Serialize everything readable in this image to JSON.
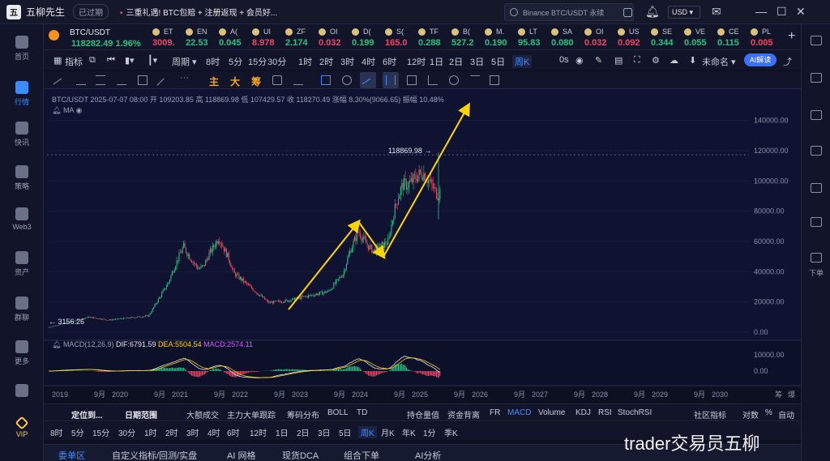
{
  "titlebar": {
    "app_name": "五柳先生",
    "expired": "已过期",
    "promo": "三重礼遇! BTC包赔 + 注册返现 + 会员好...",
    "search_placeholder": "Binance BTC/USDT 永续",
    "currency": "USD"
  },
  "leftnav": [
    {
      "label": "首页",
      "icon": "home-icon"
    },
    {
      "label": "行情",
      "icon": "chart-icon",
      "active": true
    },
    {
      "label": "快讯",
      "icon": "news-icon"
    },
    {
      "label": "策略",
      "icon": "robot-icon"
    },
    {
      "label": "Web3",
      "icon": "web3-icon"
    },
    {
      "label": "资产",
      "icon": "wallet-icon"
    },
    {
      "label": "群聊",
      "icon": "chat-icon"
    },
    {
      "label": "更多",
      "icon": "more-icon"
    },
    {
      "label": "",
      "icon": "phone-icon"
    },
    {
      "label": "VIP",
      "icon": "vip-icon"
    }
  ],
  "ticker": {
    "active_symbol": "BTC/USDT",
    "active_price": "118282.49",
    "active_change": "1.96%",
    "items": [
      {
        "sym": "ET",
        "val": "3009.",
        "dir": "down"
      },
      {
        "sym": "EN",
        "val": "22.53",
        "dir": "up"
      },
      {
        "sym": "A(",
        "val": "0.045",
        "dir": "up"
      },
      {
        "sym": "UI",
        "val": "8.978",
        "dir": "down"
      },
      {
        "sym": "ZF",
        "val": "2.174",
        "dir": "up"
      },
      {
        "sym": "OI",
        "val": "0.032",
        "dir": "down"
      },
      {
        "sym": "D(",
        "val": "0.199",
        "dir": "up"
      },
      {
        "sym": "S(",
        "val": "165.0",
        "dir": "down"
      },
      {
        "sym": "TF",
        "val": "0.288",
        "dir": "up"
      },
      {
        "sym": "B(",
        "val": "527.2",
        "dir": "up"
      },
      {
        "sym": "M.",
        "val": "0.190",
        "dir": "up"
      },
      {
        "sym": "LT",
        "val": "95.83",
        "dir": "up"
      },
      {
        "sym": "SA",
        "val": "0.080",
        "dir": "up"
      },
      {
        "sym": "OI",
        "val": "0.032",
        "dir": "down"
      },
      {
        "sym": "US",
        "val": "0.092",
        "dir": "down"
      },
      {
        "sym": "SE",
        "val": "0.344",
        "dir": "up"
      },
      {
        "sym": "VE",
        "val": "0.055",
        "dir": "up"
      },
      {
        "sym": "CE",
        "val": "0.115",
        "dir": "up"
      },
      {
        "sym": "PL",
        "val": "0.005",
        "dir": "down"
      }
    ]
  },
  "toolbar1": {
    "indicators": "指标",
    "period": "周期",
    "timeframes": [
      "8时",
      "5分",
      "15分",
      "30分",
      "1时",
      "2时",
      "3时",
      "4时",
      "6时",
      "12时",
      "1日",
      "2日",
      "3日",
      "5日",
      "周K"
    ],
    "selected_tf": "周K",
    "countdown": "0s",
    "layout_name": "未命名",
    "ai_button": "AI解读"
  },
  "toolbar2": {
    "text_tools": [
      "主",
      "大",
      "筹"
    ]
  },
  "chart": {
    "info": "BTC/USDT  2025-07-07 08:00  开 109203.85  高 118869.98  低 107429.57  收 118270.49  涨幅 8.30%(9066.65)  振幅 10.48%",
    "ma_label": "MA",
    "high_label": "118869.98",
    "low_label": "3156.26",
    "macd_label": "MACD(12,26,9)",
    "dif": "DIF:6791.59",
    "dea": "DEA:5504.54",
    "macd": "MACD:2574.11",
    "price_axis": [
      "140000.00",
      "120000.00",
      "100000.00",
      "80000.00",
      "60000.00",
      "40000.00",
      "20000.00",
      "0.00"
    ],
    "macd_axis": [
      "10000.00",
      "0.00"
    ],
    "time_axis": [
      "2019",
      "9月",
      "2020",
      "9月",
      "2021",
      "9月",
      "2022",
      "9月",
      "2023",
      "9月",
      "2024",
      "9月",
      "2025",
      "9月",
      "2026",
      "9月",
      "2027",
      "9月",
      "2028",
      "9月",
      "2029",
      "9月",
      "2030",
      "筹",
      "爆"
    ],
    "colors": {
      "up": "#26c281",
      "down": "#f04864",
      "arrow": "#ffd400",
      "dif": "#e6e8ef",
      "dea": "#ffd400"
    }
  },
  "chart_data": {
    "type": "candlestick",
    "x_unit": "week",
    "y_unit": "USDT",
    "ylim": [
      0,
      150000
    ],
    "x": [
      "2019-01",
      "2019-09",
      "2020-01",
      "2020-09",
      "2021-01",
      "2021-09",
      "2022-01",
      "2022-09",
      "2023-01",
      "2023-09",
      "2024-01",
      "2024-09",
      "2025-01",
      "2025-07"
    ],
    "close": [
      3156,
      10000,
      8000,
      10800,
      33000,
      45000,
      42000,
      19500,
      21000,
      27000,
      43000,
      60000,
      95000,
      118270
    ],
    "high": [
      3800,
      12000,
      10000,
      12500,
      41000,
      52000,
      69000,
      22000,
      24000,
      30000,
      73000,
      66000,
      109000,
      118869.98
    ],
    "low": [
      3156.26,
      7000,
      3800,
      9800,
      28000,
      29000,
      33000,
      15500,
      16500,
      25000,
      38000,
      49000,
      75000,
      74500
    ],
    "arrows": [
      {
        "from": [
          "2023-01",
          15000
        ],
        "to": [
          "2024-03",
          73000
        ]
      },
      {
        "from": [
          "2024-03",
          73000
        ],
        "to": [
          "2024-08",
          50000
        ]
      },
      {
        "from": [
          "2024-08",
          50000
        ],
        "to": [
          "2026-01",
          150000
        ]
      }
    ]
  },
  "indicator_bar": {
    "locate": "定位到...",
    "date_range": "日期范围",
    "items": [
      "大额成交",
      "主力大单跟踪",
      "筹码分布",
      "BOLL",
      "TD"
    ],
    "items2": [
      "持仓量值",
      "资金背离",
      "FR",
      "MACD",
      "Volume",
      "KDJ",
      "RSI",
      "StochRSI"
    ],
    "active": "MACD",
    "community": "社区指标",
    "log": "对数",
    "pct": "%",
    "auto": "自动"
  },
  "tf_bar": {
    "items": [
      "8时",
      "5分",
      "15分",
      "30分",
      "1时",
      "2时",
      "3时",
      "4时",
      "6时",
      "12时",
      "1日",
      "2日",
      "3日",
      "5日",
      "周K",
      "月K",
      "年K",
      "1分",
      "季K"
    ],
    "selected": "周K"
  },
  "bottom_tabs": [
    "委单区",
    "自定义指标/回测/实盘",
    "AI 网格",
    "现货DCA",
    "组合下单",
    "AI分析"
  ],
  "watermark": "trader交易员五柳"
}
